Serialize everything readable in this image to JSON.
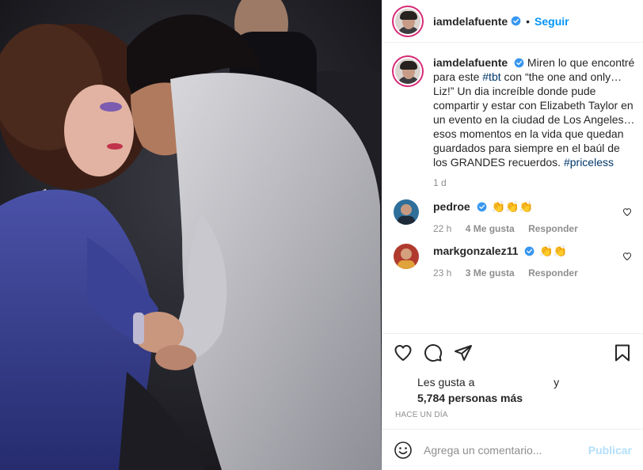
{
  "post": {
    "author": "iamdelafuente",
    "follow_label": "Seguir",
    "separator": "•"
  },
  "caption": {
    "username": "iamdelafuente",
    "text_before": "Miren lo que encontré para este",
    "hashtag1": "#tbt",
    "text_middle": "con “the one and only… Liz!” Un dia increíble donde pude compartir y estar con Elizabeth Taylor en un evento en la ciudad de Los Angeles… esos momentos en la vida que quedan guardados para siempre en el baúl de los GRANDES recuerdos.",
    "hashtag2": "#priceless",
    "time": "1 d"
  },
  "comments": [
    {
      "username": "pedroe",
      "text": "👏👏👏",
      "time": "22 h",
      "likes": "4 Me gusta",
      "reply": "Responder"
    },
    {
      "username": "markgonzalez11",
      "text": "👏👏",
      "time": "23 h",
      "likes": "3 Me gusta",
      "reply": "Responder"
    }
  ],
  "likes": {
    "prefix": "Les gusta a",
    "and": "y",
    "count_text": "5,784 personas más"
  },
  "posted_ago": "HACE UN DÍA",
  "add_comment": {
    "placeholder": "Agrega un comentario...",
    "publish_label": "Publicar"
  },
  "colors": {
    "link": "#0095f6",
    "hashtag": "#00376b",
    "muted": "#8e8e8e",
    "publish_disabled": "#b2dffc",
    "verified": "#3897f0"
  },
  "icons": [
    "verified-badge-icon",
    "heart-icon",
    "comment-icon",
    "share-icon",
    "bookmark-icon",
    "emoji-icon",
    "comment-like-icon"
  ]
}
